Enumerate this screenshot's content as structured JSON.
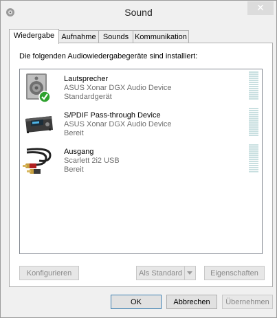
{
  "window": {
    "title": "Sound"
  },
  "tabs": [
    {
      "label": "Wiedergabe"
    },
    {
      "label": "Aufnahme"
    },
    {
      "label": "Sounds"
    },
    {
      "label": "Kommunikation"
    }
  ],
  "panel": {
    "caption": "Die folgenden Audiowiedergabegeräte sind installiert:"
  },
  "devices": [
    {
      "name": "Lautsprecher",
      "driver": "ASUS Xonar DGX Audio Device",
      "status": "Standardgerät",
      "icon": "speaker-icon"
    },
    {
      "name": "S/PDIF Pass-through Device",
      "driver": "ASUS Xonar DGX Audio Device",
      "status": "Bereit",
      "icon": "receiver-icon"
    },
    {
      "name": "Ausgang",
      "driver": "Scarlett 2i2 USB",
      "status": "Bereit",
      "icon": "rca-cable-icon"
    }
  ],
  "panel_buttons": {
    "configure": "Konfigurieren",
    "set_default": "Als Standard",
    "properties": "Eigenschaften"
  },
  "dialog_buttons": {
    "ok": "OK",
    "cancel": "Abbrechen",
    "apply": "Übernehmen"
  },
  "colors": {
    "checkmark": "#2ea12e",
    "meter": "#c8dfe0",
    "default_border": "#3c7fb1"
  }
}
